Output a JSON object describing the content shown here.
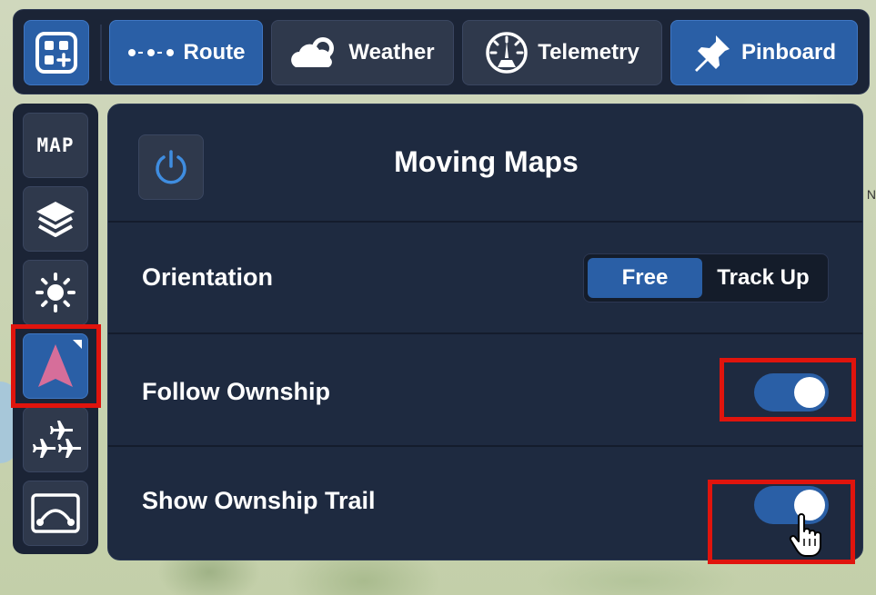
{
  "toolbar": {
    "route_label": "Route",
    "weather_label": "Weather",
    "telemetry_label": "Telemetry",
    "pinboard_label": "Pinboard"
  },
  "sidebar": {
    "map_label": "MAP"
  },
  "map": {
    "edge_label": "N"
  },
  "panel": {
    "title": "Moving Maps",
    "orientation": {
      "label": "Orientation",
      "options": [
        "Free",
        "Track Up"
      ],
      "selected": "Free"
    },
    "follow_ownship": {
      "label": "Follow Ownship",
      "enabled": true
    },
    "show_trail": {
      "label": "Show Ownship Trail",
      "enabled": true
    }
  },
  "colors": {
    "accent": "#2a5fa6",
    "panel_bg": "#1e2a40",
    "highlight": "#e0140d",
    "ownship_icon": "#d66e9a"
  }
}
